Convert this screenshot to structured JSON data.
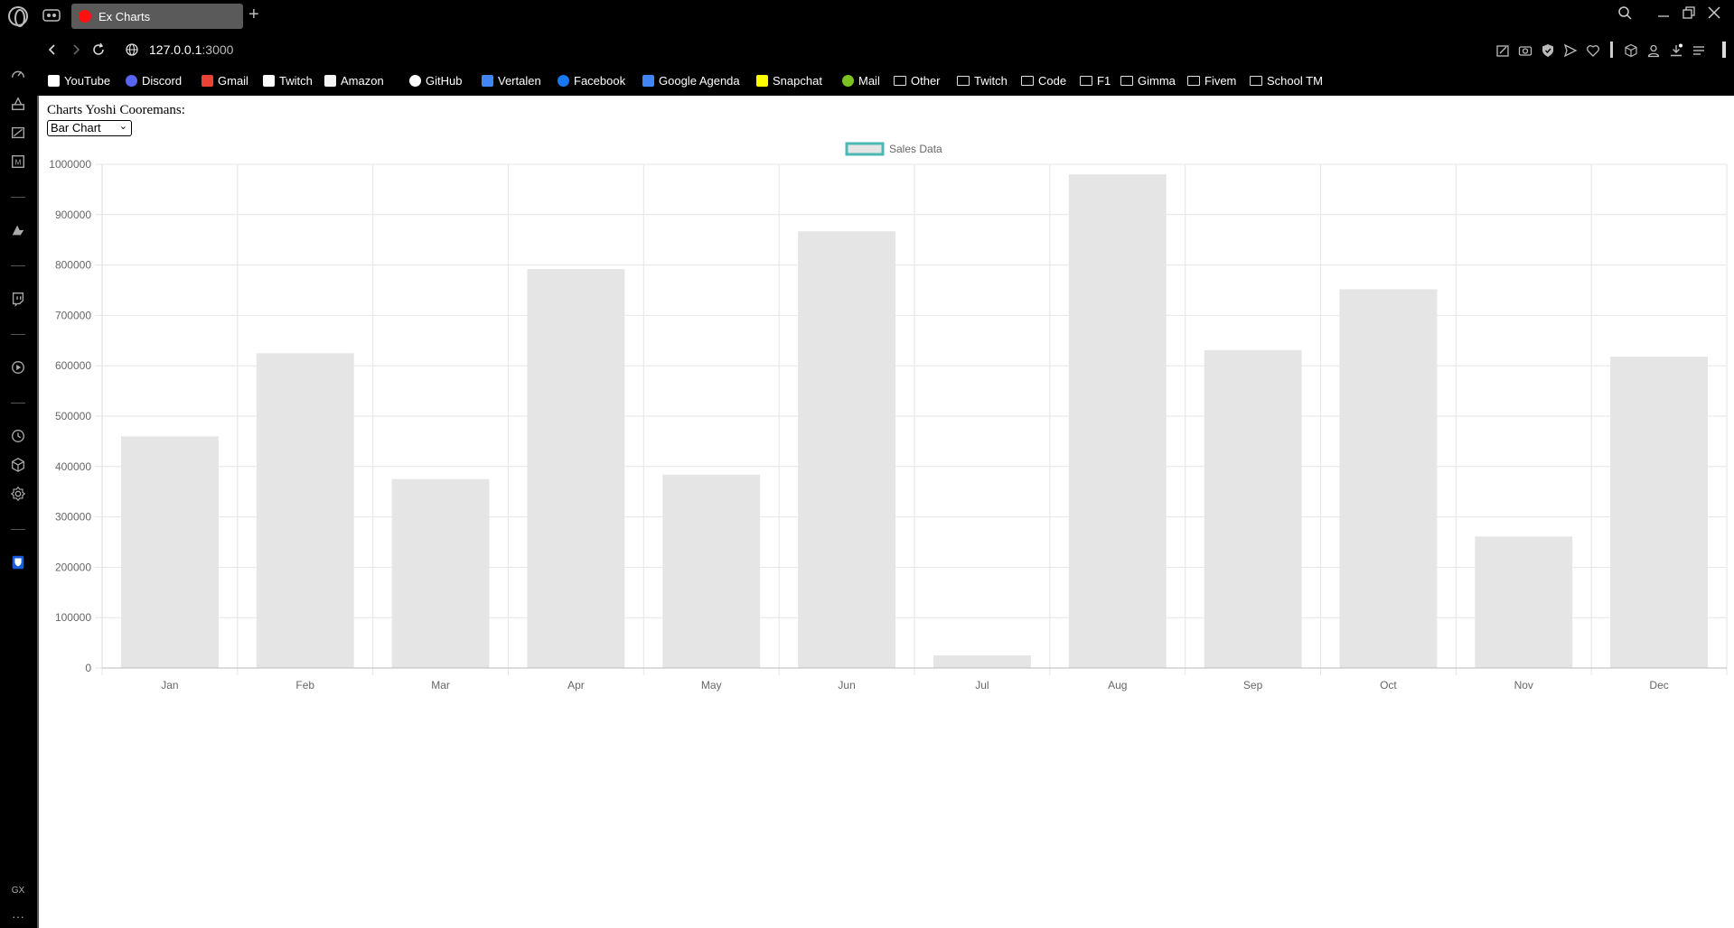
{
  "browser": {
    "tab_title": "Ex Charts",
    "url_host": "127.0.0.1",
    "url_port": ":3000",
    "gx_label": "GX",
    "more_label": "···"
  },
  "bookmarks": [
    {
      "label": "YouTube",
      "icon": "page-icon"
    },
    {
      "label": "Discord",
      "icon": "discord-icon"
    },
    {
      "label": "Gmail",
      "icon": "gmail-icon"
    },
    {
      "label": "Twitch",
      "icon": "page-icon"
    },
    {
      "label": "Amazon",
      "icon": "amazon-icon"
    },
    {
      "label": "GitHub",
      "icon": "github-icon"
    },
    {
      "label": "Vertalen",
      "icon": "translate-icon"
    },
    {
      "label": "Facebook",
      "icon": "facebook-icon"
    },
    {
      "label": "Google Agenda",
      "icon": "calendar-icon"
    },
    {
      "label": "Snapchat",
      "icon": "snapchat-icon"
    },
    {
      "label": "Mail",
      "icon": "mail-icon"
    },
    {
      "label": "Other",
      "icon": "folder-icon"
    },
    {
      "label": "Twitch",
      "icon": "folder-icon"
    },
    {
      "label": "Code",
      "icon": "folder-icon"
    },
    {
      "label": "F1",
      "icon": "folder-icon"
    },
    {
      "label": "Gimma",
      "icon": "folder-icon"
    },
    {
      "label": "Fivem",
      "icon": "folder-icon"
    },
    {
      "label": "School TM",
      "icon": "folder-icon"
    }
  ],
  "page": {
    "title": "Charts Yoshi Cooremans:",
    "select_value": "Bar Chart"
  },
  "chart_data": {
    "type": "bar",
    "categories": [
      "Jan",
      "Feb",
      "Mar",
      "Apr",
      "May",
      "Jun",
      "Jul",
      "Aug",
      "Sep",
      "Oct",
      "Nov",
      "Dec"
    ],
    "series": [
      {
        "name": "Sales Data",
        "values": [
          460000,
          625000,
          375000,
          792000,
          384000,
          867000,
          25000,
          980000,
          631000,
          752000,
          261000,
          618000
        ]
      }
    ],
    "y_ticks": [
      "0",
      "100000",
      "200000",
      "300000",
      "400000",
      "500000",
      "600000",
      "700000",
      "800000",
      "900000",
      "1000000"
    ],
    "ylim": [
      0,
      1000000
    ],
    "grid": true,
    "legend": "top-center",
    "colors": {
      "bar": "#e5e5e5",
      "legend_border": "#4bb8b4",
      "grid": "#e6e6e6"
    }
  }
}
